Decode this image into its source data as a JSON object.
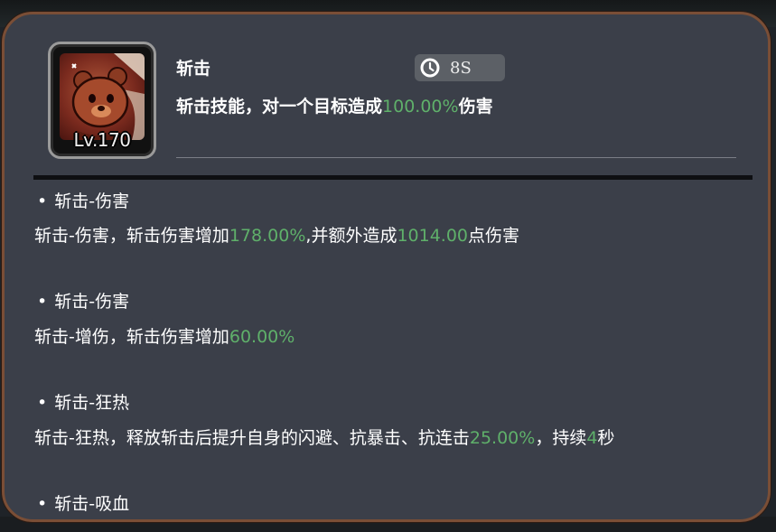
{
  "skill": {
    "name": "斩击",
    "level": "Lv.170",
    "cooldown": "8S",
    "desc_prefix": "斩击技能，对一个目标造成",
    "desc_value": "100.00%",
    "desc_suffix": "伤害"
  },
  "icons": {
    "cooldown": "clock-icon",
    "avatar": "bear-avatar-icon",
    "bullet": "•"
  },
  "colors": {
    "panel_bg": "#3b3f49",
    "panel_border": "#7a4e36",
    "highlight": "#5fb06a",
    "text": "#ffffff"
  },
  "effects": [
    {
      "title": "斩击-伤害",
      "desc_parts": [
        {
          "text": "斩击-伤害，斩击伤害增加",
          "green": false
        },
        {
          "text": "178.00%",
          "green": true
        },
        {
          "text": ",并额外造成",
          "green": false
        },
        {
          "text": "1014.00",
          "green": true
        },
        {
          "text": "点伤害",
          "green": false
        }
      ]
    },
    {
      "title": "斩击-伤害",
      "desc_parts": [
        {
          "text": "斩击-增伤，斩击伤害增加",
          "green": false
        },
        {
          "text": "60.00%",
          "green": true
        }
      ]
    },
    {
      "title": "斩击-狂热",
      "desc_parts": [
        {
          "text": "斩击-狂热，释放斩击后提升自身的闪避、抗暴击、抗连击",
          "green": false
        },
        {
          "text": "25.00%",
          "green": true
        },
        {
          "text": "，持续",
          "green": false
        },
        {
          "text": "4",
          "green": true
        },
        {
          "text": "秒",
          "green": false
        }
      ]
    },
    {
      "title": "斩击-吸血",
      "desc_parts": []
    }
  ]
}
